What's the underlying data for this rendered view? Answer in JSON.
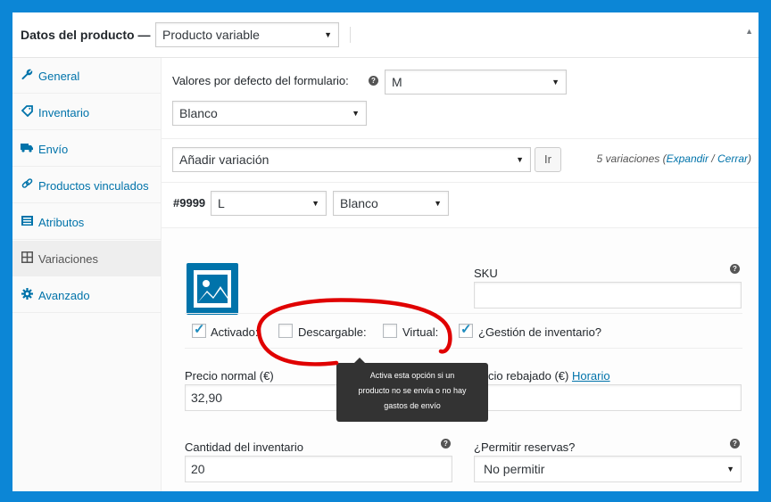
{
  "header": {
    "title": "Datos del producto —",
    "product_type": "Producto variable"
  },
  "sidebar": {
    "items": [
      {
        "label": "General",
        "icon": "wrench-icon"
      },
      {
        "label": "Inventario",
        "icon": "tag-icon"
      },
      {
        "label": "Envío",
        "icon": "truck-icon"
      },
      {
        "label": "Productos vinculados",
        "icon": "link-icon"
      },
      {
        "label": "Atributos",
        "icon": "list-icon"
      },
      {
        "label": "Variaciones",
        "icon": "grid-icon"
      },
      {
        "label": "Avanzado",
        "icon": "gear-icon"
      }
    ],
    "active_index": 5
  },
  "defaults": {
    "label": "Valores por defecto del formulario:",
    "size_value": "M",
    "color_value": "Blanco"
  },
  "add_variation": {
    "select_value": "Añadir variación",
    "go_label": "Ir",
    "count_text": "5 variaciones (",
    "expand_label": "Expandir",
    "separator": " / ",
    "close_label": "Cerrar",
    "close_paren": ")"
  },
  "variation": {
    "id": "#9999",
    "size_value": "L",
    "color_value": "Blanco",
    "sku_label": "SKU",
    "sku_value": "",
    "checkboxes": [
      {
        "label": "Activado:",
        "checked": true
      },
      {
        "label": "Descargable:",
        "checked": false
      },
      {
        "label": "Virtual:",
        "checked": false
      },
      {
        "label": "¿Gestión de inventario?",
        "checked": true
      }
    ],
    "tooltip_lines": [
      "Activa esta opción si un",
      "producto no se envía o no hay",
      "gastos de envío"
    ],
    "regular_price_label": "Precio normal (€)",
    "regular_price_value": "32,90",
    "sale_price_label": "cio rebajado (€)",
    "schedule_label": "Horario",
    "sale_price_value": "",
    "stock_qty_label": "Cantidad del inventario",
    "stock_qty_value": "20",
    "backorders_label": "¿Permitir reservas?",
    "backorders_value": "No permitir"
  },
  "colors": {
    "border_frame": "#0c86d6",
    "link": "#0073aa",
    "annotation": "#e00000"
  }
}
